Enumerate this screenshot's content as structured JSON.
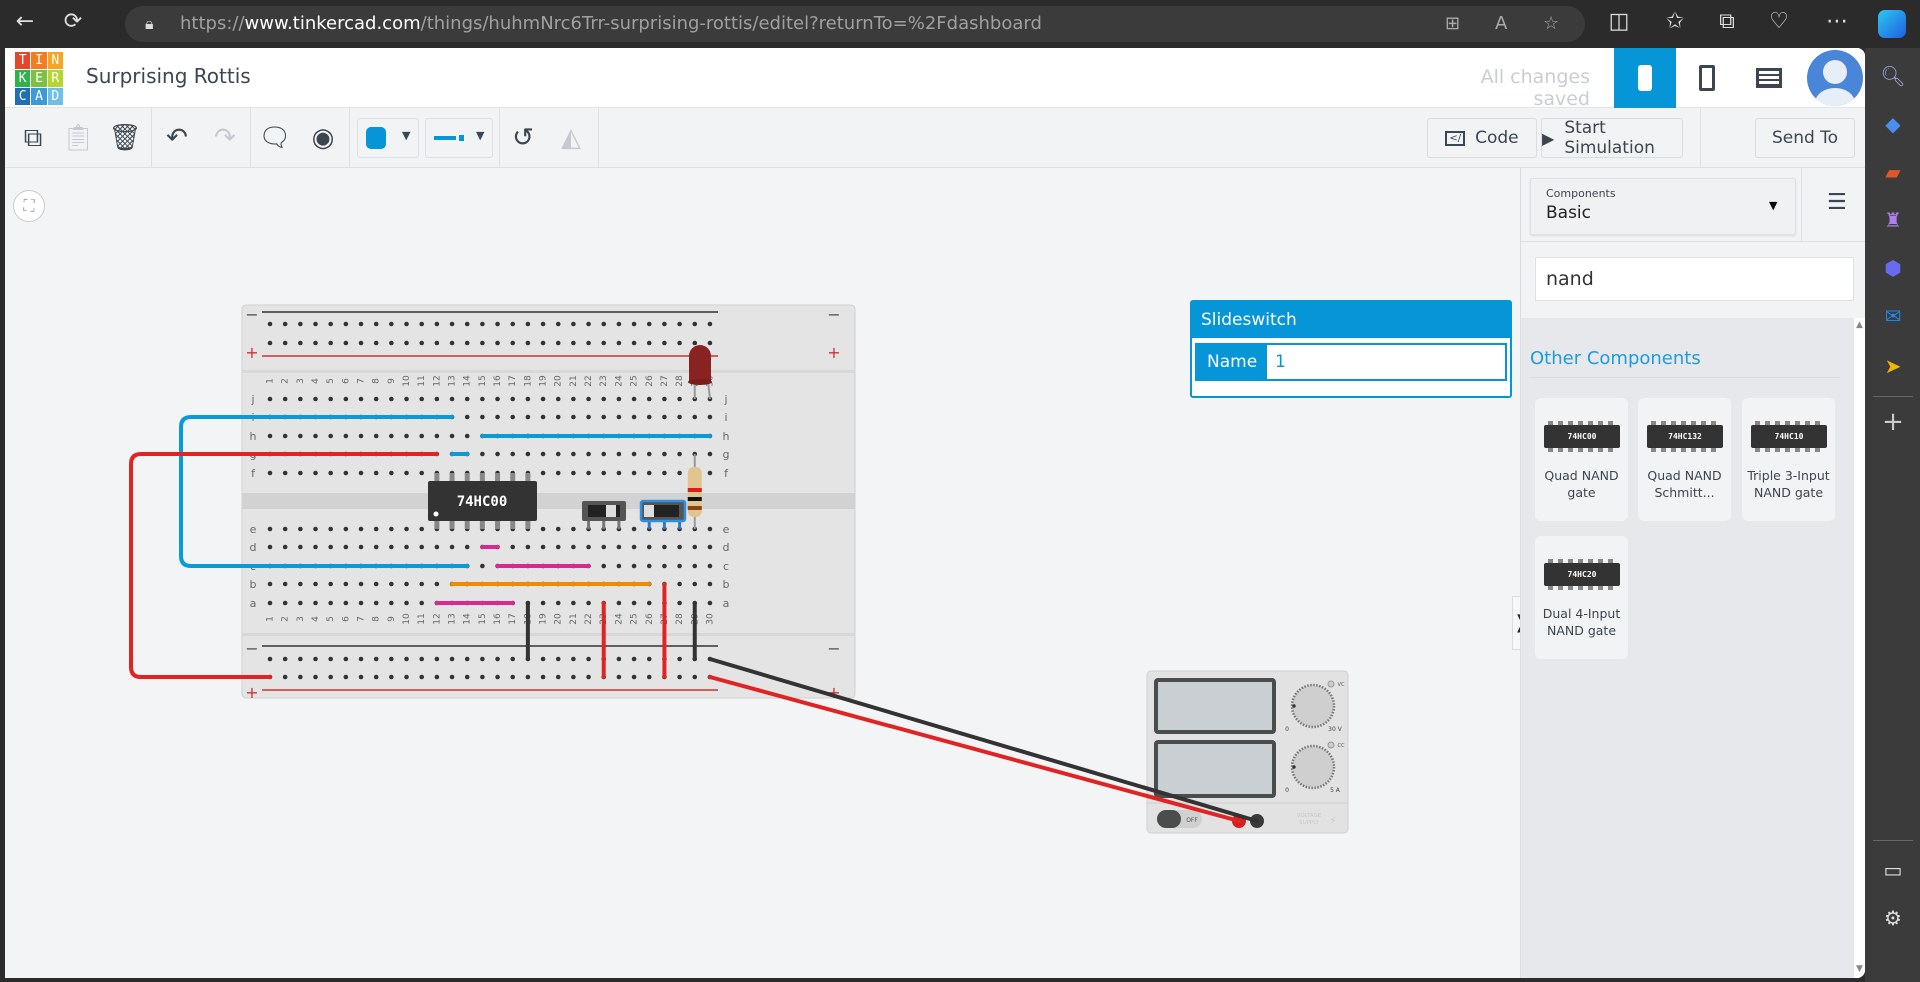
{
  "browser": {
    "url_prefix": "https://",
    "url_host": "www.tinkercad.com",
    "url_path": "/things/huhmNrc6Trr-surprising-rottis/editel?returnTo=%2Fdashboard",
    "icons": [
      "back-icon",
      "refresh-icon",
      "lock-icon",
      "apps-icon",
      "read-aloud-icon",
      "favorite-icon",
      "split-screen-icon",
      "favorites-icon",
      "collections-icon",
      "browser-essentials-icon",
      "more-icon",
      "copilot-icon"
    ],
    "sidebar_icons": [
      "search-icon",
      "shopping-icon",
      "tools-icon",
      "games-icon",
      "microsoft365-icon",
      "outlook-icon",
      "send-icon",
      "add-icon",
      "sidebar-toggle-icon",
      "settings-icon"
    ]
  },
  "header": {
    "logo": [
      "T",
      "I",
      "N",
      "K",
      "E",
      "R",
      "C",
      "A",
      "D"
    ],
    "title": "Surprising Rottis",
    "status": "All changes saved",
    "accent": "#0695d6"
  },
  "toolbar": {
    "code": "Code",
    "start_simulation": "Start Simulation",
    "send_to": "Send To",
    "wire_color": "#0695d6"
  },
  "inspector": {
    "title": "Slideswitch",
    "name_label": "Name",
    "name_value": "1"
  },
  "components_panel": {
    "select_label": "Components",
    "select_value": "Basic",
    "search_value": "nand",
    "section": "Other Components",
    "items": [
      {
        "chip": "74HC00",
        "label": "Quad NAND gate"
      },
      {
        "chip": "74HC132",
        "label": "Quad NAND Schmitt..."
      },
      {
        "chip": "74HC10",
        "label": "Triple 3-Input NAND gate"
      },
      {
        "chip": "74HC20",
        "label": "Dual 4-Input NAND gate"
      }
    ]
  },
  "circuit": {
    "chip_label": "74HC00",
    "row_letters_top": [
      "j",
      "i",
      "h",
      "g",
      "f"
    ],
    "row_letters_bottom": [
      "e",
      "d",
      "c",
      "b",
      "a"
    ],
    "rail_minus": "−",
    "rail_plus": "+",
    "wires": [
      {
        "color": "#0a9bd7",
        "from": "i13",
        "to": "c14",
        "route": "left-loop"
      },
      {
        "color": "#e02424",
        "from": "g12",
        "to": "bot+1",
        "route": "left-loop"
      },
      {
        "color": "#0a9bd7",
        "from": "g13",
        "to": "g14"
      },
      {
        "color": "#0a9bd7",
        "from": "h15",
        "to": "h30"
      },
      {
        "color": "#d9288f",
        "from": "d15",
        "to": "d16"
      },
      {
        "color": "#d9288f",
        "from": "c16",
        "to": "c22"
      },
      {
        "color": "#f08a00",
        "from": "b13",
        "to": "b26"
      },
      {
        "color": "#d9288f",
        "from": "a12",
        "to": "a17"
      },
      {
        "color": "#333333",
        "from": "a18",
        "to": "bot-18"
      },
      {
        "color": "#e02424",
        "from": "a23",
        "to": "bot+23"
      },
      {
        "color": "#e02424",
        "from": "b27",
        "to": "bot+27"
      },
      {
        "color": "#333333",
        "from": "a29",
        "to": "bot-29"
      }
    ],
    "power_supply": {
      "vc": "VC",
      "cc": "CC",
      "v_min": "0",
      "v_max": "30 V",
      "a_min": "0",
      "a_max": "5 A",
      "switch": "OFF",
      "brand": "VOLTAGE SUPPLY"
    }
  }
}
